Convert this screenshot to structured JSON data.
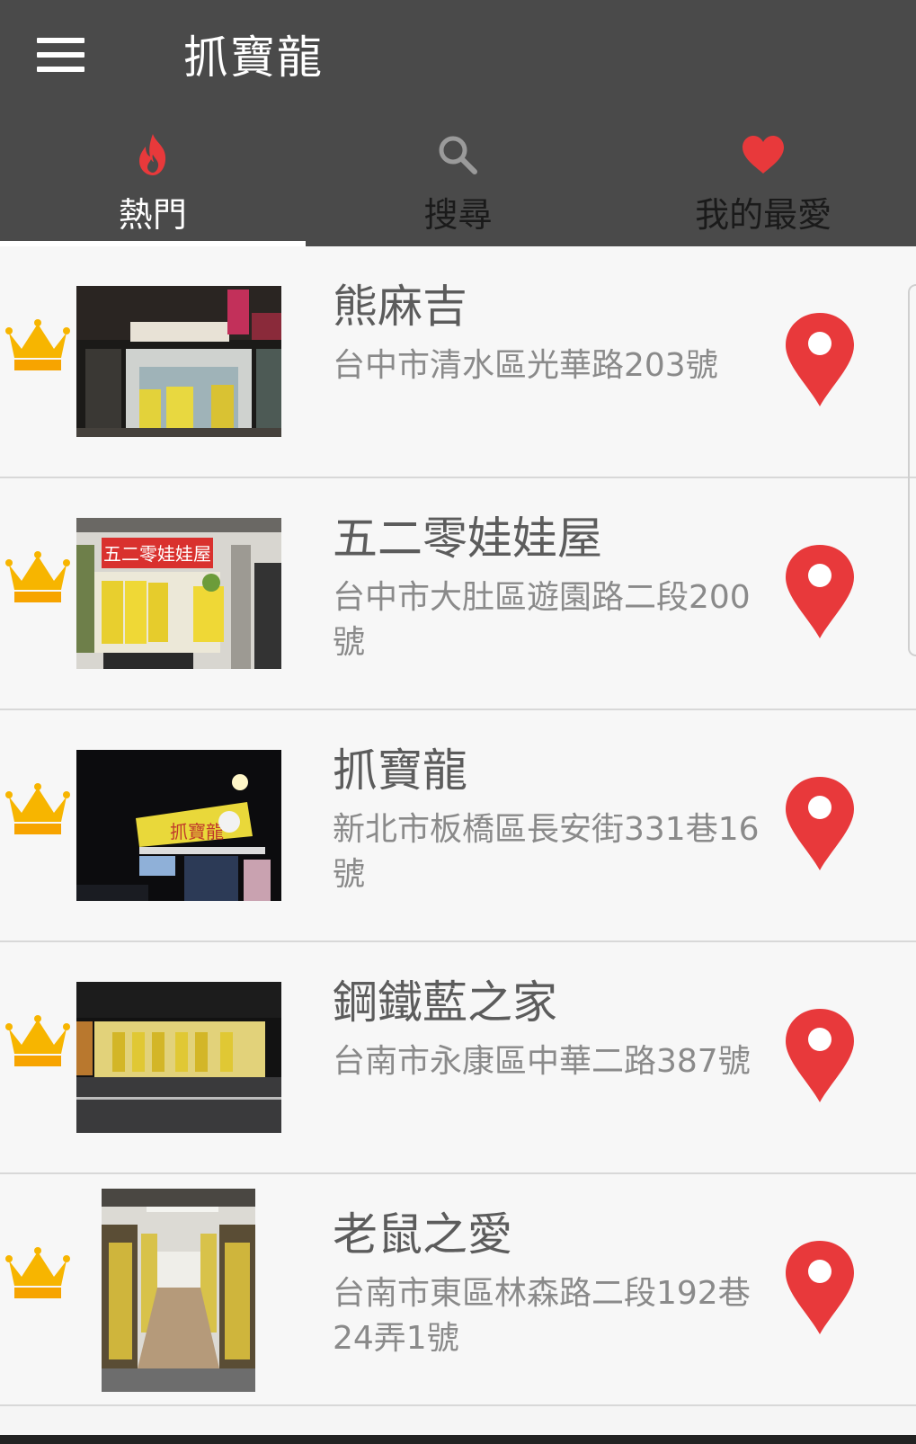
{
  "app": {
    "title": "抓寶龍"
  },
  "tabs": [
    {
      "label": "熱門",
      "icon": "flame-icon",
      "active": true
    },
    {
      "label": "搜尋",
      "icon": "search-icon",
      "active": false
    },
    {
      "label": "我的最愛",
      "icon": "heart-icon",
      "active": false
    }
  ],
  "colors": {
    "appbar": "#4a4a4a",
    "accent_red": "#e8393b",
    "crown_gold": "#f7b500",
    "text_primary": "#5c5c5c",
    "text_secondary": "#8a8a8a"
  },
  "stores": [
    {
      "name": "熊麻吉",
      "address": "台中市清水區光華路203號"
    },
    {
      "name": "五二零娃娃屋",
      "address": "台中市大肚區遊園路二段200號"
    },
    {
      "name": "抓寶龍",
      "address": "新北市板橋區長安街331巷16號"
    },
    {
      "name": "鋼鐵藍之家",
      "address": "台南市永康區中華二路387號"
    },
    {
      "name": "老鼠之愛",
      "address": "台南市東區林森路二段192巷24弄1號"
    }
  ],
  "thumbnails": [
    {
      "sign_text": ""
    },
    {
      "sign_text": "五二零娃娃屋"
    },
    {
      "sign_text": "抓寶龍"
    },
    {
      "sign_text": ""
    },
    {
      "sign_text": ""
    }
  ]
}
